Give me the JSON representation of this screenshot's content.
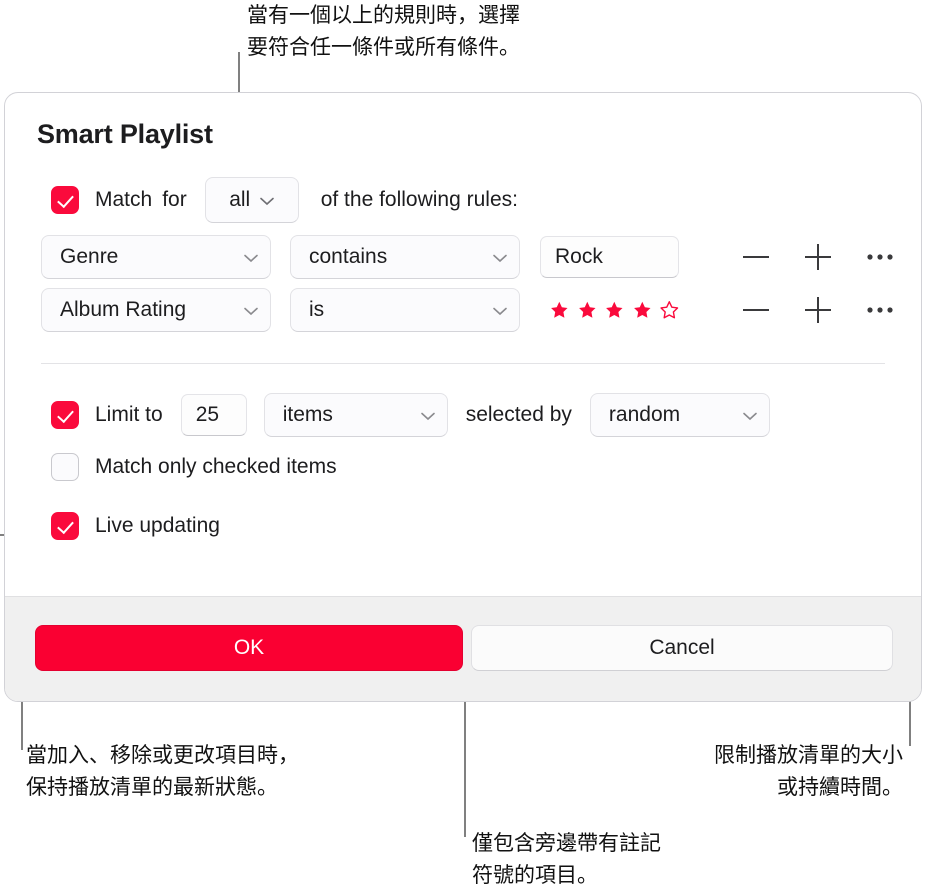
{
  "callouts": {
    "top": "當有一個以上的規則時，選擇\n要符合任一條件或所有條件。",
    "bottom_left": "當加入、移除或更改項目時，\n保持播放清單的最新狀態。",
    "bottom_center": "僅包含旁邊帶有註記\n符號的項目。",
    "bottom_right": "限制播放清單的大小\n或持續時間。"
  },
  "dialog": {
    "title": "Smart Playlist",
    "match_row": {
      "checked": true,
      "label_match": "Match",
      "label_for": "for",
      "operator": "all",
      "label_suffix": "of the following rules:"
    },
    "rules": [
      {
        "field": "Genre",
        "condition": "contains",
        "value_type": "text",
        "value": "Rock",
        "remove_label": "−",
        "add_label": "+",
        "more_label": "•••"
      },
      {
        "field": "Album Rating",
        "condition": "is",
        "value_type": "stars",
        "stars_filled": 4,
        "stars_total": 5,
        "remove_label": "−",
        "add_label": "+",
        "more_label": "•••"
      }
    ],
    "limit_row": {
      "checked": true,
      "label": "Limit to",
      "amount": "25",
      "unit": "items",
      "label_selected_by": "selected by",
      "selection": "random"
    },
    "match_checked_row": {
      "checked": false,
      "label": "Match only checked items"
    },
    "live_updating_row": {
      "checked": true,
      "label": "Live updating"
    },
    "buttons": {
      "ok": "OK",
      "cancel": "Cancel"
    }
  },
  "colors": {
    "accent_red": "#fa0a3c",
    "button_red": "#fa0032",
    "star_red": "#fa0a3c",
    "leader_gray": "#808080",
    "footer_bg": "#f0f0f0"
  }
}
